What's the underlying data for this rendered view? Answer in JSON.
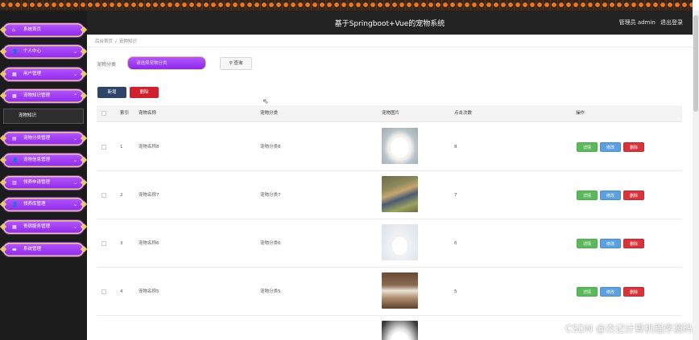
{
  "header": {
    "title": "基于Springboot+Vue的宠物系统",
    "user": "管理员 admin",
    "logout": "退出登录"
  },
  "sidebar": {
    "items": [
      {
        "label": "系统首页",
        "icon": "⌂",
        "arrow": ""
      },
      {
        "label": "个人中心",
        "icon": "👤",
        "arrow": "⌄"
      },
      {
        "label": "用户管理",
        "icon": "▦",
        "arrow": "⌄"
      },
      {
        "label": "宠物知识管理",
        "icon": "▦",
        "arrow": "⌃"
      },
      {
        "label": "宠物分类管理",
        "icon": "▤",
        "arrow": "⌄"
      },
      {
        "label": "宠物信息管理",
        "icon": "👤",
        "arrow": "⌄"
      },
      {
        "label": "领养申请管理",
        "icon": "▥",
        "arrow": "⌄"
      },
      {
        "label": "领养库管理",
        "icon": "👤",
        "arrow": "⌄"
      },
      {
        "label": "寄宿服务管理",
        "icon": "▦",
        "arrow": "⌄"
      },
      {
        "label": "系统管理",
        "icon": "▬",
        "arrow": ""
      }
    ],
    "submenu": "宠物知识"
  },
  "breadcrumb": [
    "后台首页",
    "宠物知识"
  ],
  "search": {
    "label": "宠物分类",
    "placeholder": "请选择宠物分类",
    "button": "查询"
  },
  "toolbar": {
    "add": "新增",
    "delete": "删除"
  },
  "table": {
    "headers": [
      "索引",
      "宠物名称",
      "宠物分类",
      "宠物图片",
      "点击次数",
      "操作"
    ],
    "rows": [
      {
        "index": "1",
        "name": "宠物名称8",
        "category": "宠物分类8",
        "clicks": "8"
      },
      {
        "index": "2",
        "name": "宠物名称7",
        "category": "宠物分类7",
        "clicks": "7"
      },
      {
        "index": "3",
        "name": "宠物名称6",
        "category": "宠物分类6",
        "clicks": "6"
      },
      {
        "index": "4",
        "name": "宠物名称5",
        "category": "宠物分类5",
        "clicks": "5"
      }
    ],
    "actions": {
      "detail": "详情",
      "edit": "修改",
      "delete": "删除"
    }
  },
  "watermark": "CSDN @杰记计算机程序源码",
  "colors": {
    "header_bg": "#232323",
    "sidebar_bg": "#1c1c1c",
    "menu_purple": "#a040f8",
    "btn_add": "#2e4569",
    "btn_delete": "#d0212f",
    "btn_detail": "#5cb85c",
    "btn_edit": "#5ba1e0"
  }
}
